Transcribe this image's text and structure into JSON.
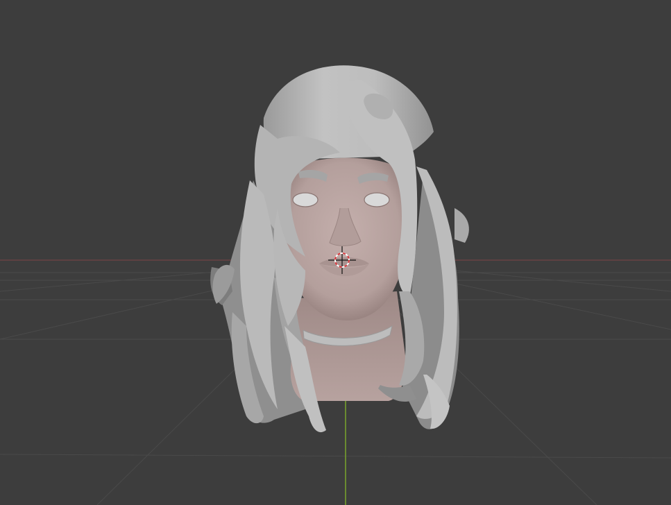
{
  "viewport": {
    "background_color": "#3d3d3d",
    "grid_color": "#4a4a4a",
    "x_axis_color": "#8a4a4e",
    "y_axis_color": "#7aa52c",
    "model": {
      "hair_color": "#b9b9b9",
      "hair_shadow_color": "#8d8d8d",
      "skin_color": "#b8a3a0",
      "skin_shadow_color": "#8f7a77",
      "eye_color": "#d8d8d8"
    },
    "cursor_3d": {
      "ring_colors": [
        "#ffffff",
        "#d9353a"
      ],
      "icon": "3d-cursor-icon"
    }
  }
}
